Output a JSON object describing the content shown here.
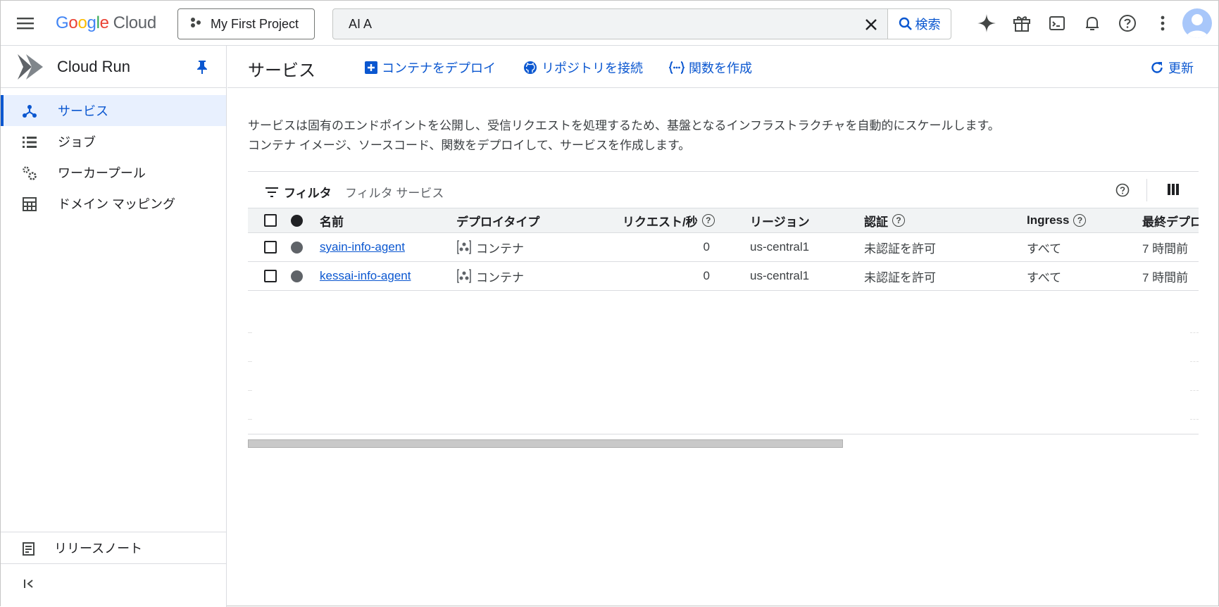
{
  "header": {
    "logo_google": [
      "G",
      "o",
      "o",
      "g",
      "l",
      "e"
    ],
    "logo_cloud": "Cloud",
    "project": "My First Project",
    "search_value": "AI A",
    "search_button": "検索"
  },
  "sidebar": {
    "product": "Cloud Run",
    "items": [
      {
        "label": "サービス",
        "active": true
      },
      {
        "label": "ジョブ"
      },
      {
        "label": "ワーカープール"
      },
      {
        "label": "ドメイン マッピング"
      }
    ],
    "release_notes": "リリースノート"
  },
  "page": {
    "title": "サービス",
    "actions": {
      "deploy": "コンテナをデプロイ",
      "repo": "リポジトリを接続",
      "function": "関数を作成",
      "refresh": "更新"
    },
    "description": [
      "サービスは固有のエンドポイントを公開し、受信リクエストを処理するため、基盤となるインフラストラクチャを自動的にスケールします。",
      "コンテナ イメージ、ソースコード、関数をデプロイして、サービスを作成します。"
    ]
  },
  "filter": {
    "label": "フィルタ",
    "placeholder": "フィルタ サービス"
  },
  "table": {
    "columns": {
      "name": "名前",
      "deploy_type": "デプロイタイプ",
      "requests": "リクエスト/秒",
      "region": "リージョン",
      "auth": "認証",
      "ingress": "Ingress",
      "last_deployed": "最終デプロ"
    },
    "rows": [
      {
        "name": "syain-info-agent",
        "deploy_type": "コンテナ",
        "requests": "0",
        "region": "us-central1",
        "auth": "未認証を許可",
        "ingress": "すべて",
        "last_deployed": "7 時間前"
      },
      {
        "name": "kessai-info-agent",
        "deploy_type": "コンテナ",
        "requests": "0",
        "region": "us-central1",
        "auth": "未認証を許可",
        "ingress": "すべて",
        "last_deployed": "7 時間前"
      }
    ]
  },
  "colors": {
    "accent": "#0b57d0",
    "active_bg": "#e8f0fe",
    "status_dot": "#5f6368"
  },
  "icons": [
    "menu-icon",
    "project-icon",
    "close-icon",
    "search-icon",
    "gemini-sparkle-icon",
    "gift-icon",
    "terminal-icon",
    "bell-icon",
    "help-icon",
    "more-vert-icon",
    "avatar",
    "cloud-run-logo-icon",
    "pin-icon",
    "services-icon",
    "jobs-icon",
    "worker-pool-icon",
    "domain-icon",
    "release-notes-icon",
    "collapse-icon",
    "add-box-icon",
    "github-icon",
    "function-icon",
    "refresh-icon",
    "filter-icon",
    "columns-icon",
    "container-icon"
  ]
}
